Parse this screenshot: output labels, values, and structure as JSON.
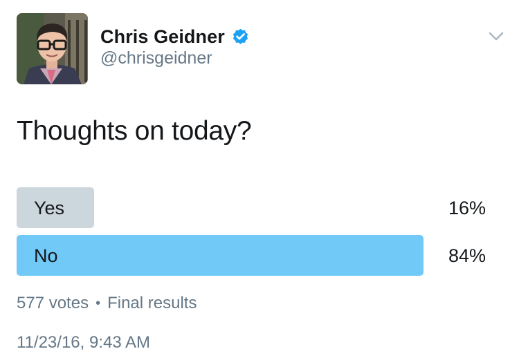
{
  "author": {
    "name": "Chris Geidner",
    "handle": "@chrisgeidner",
    "verified": true,
    "avatar_icon": "profile-photo",
    "menu_icon": "chevron-down-icon"
  },
  "tweet": {
    "text": "Thoughts on today?"
  },
  "poll": {
    "choices": [
      {
        "label": "Yes",
        "percent_text": "16%",
        "percent": 16,
        "leading": false,
        "bar_color": "#ccd6dd"
      },
      {
        "label": "No",
        "percent_text": "84%",
        "percent": 84,
        "leading": true,
        "bar_color": "#71c9f8"
      }
    ],
    "votes": "577 votes",
    "separator": "•",
    "status": "Final results"
  },
  "timestamp": "11/23/16, 9:43 AM",
  "colors": {
    "verified_blue": "#1da1f2",
    "secondary_text": "#657786",
    "primary_text": "#14171a"
  }
}
